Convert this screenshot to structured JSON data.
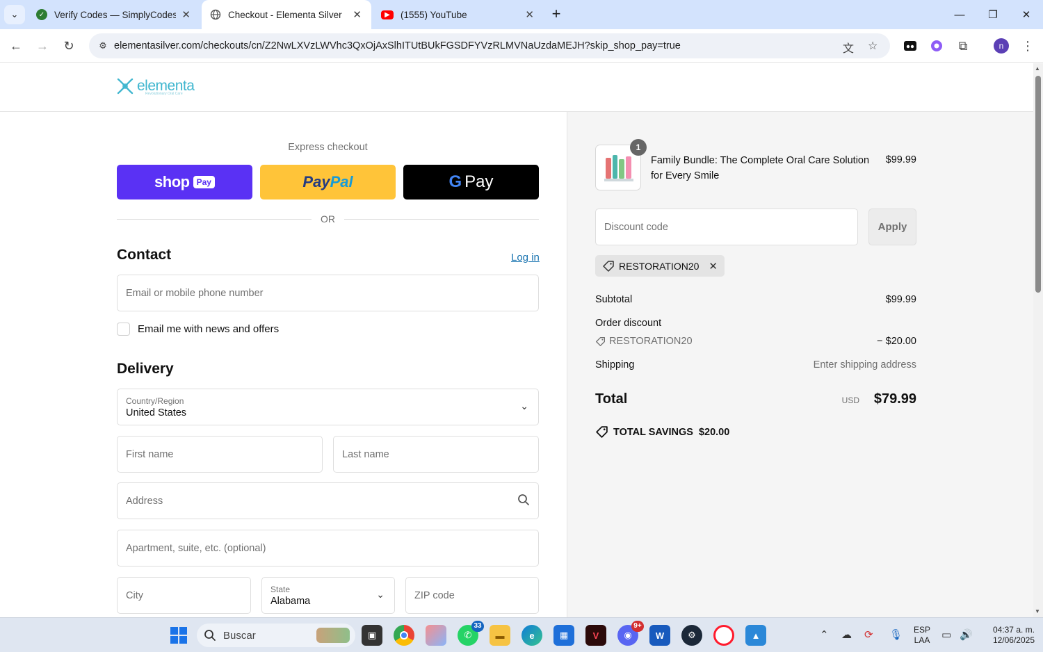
{
  "browser": {
    "tabs": [
      {
        "title": "Verify Codes — SimplyCodes",
        "icon": "simplycodes-icon",
        "color": "#2e7d32"
      },
      {
        "title": "Checkout - Elementa Silver",
        "icon": "globe-icon",
        "active": true
      },
      {
        "title": "(1555) YouTube",
        "icon": "youtube-icon",
        "color": "#ff0000"
      }
    ],
    "url": "elementasilver.com/checkouts/cn/Z2NwLXVzLWVhc3QxOjAxSlhITUtBUkFGSDFYVzRLMVNaUzdaMEJH?skip_shop_pay=true",
    "profile_initial": "n"
  },
  "store": {
    "logo_text": "elementa",
    "logo_sub": "Revolutionary Oral Care"
  },
  "express": {
    "label": "Express checkout",
    "shop": "shop",
    "shop_pay": "Pay",
    "paypal_a": "Pay",
    "paypal_b": "Pal",
    "gpay": "Pay",
    "or": "OR"
  },
  "contact": {
    "heading": "Contact",
    "login": "Log in",
    "email_placeholder": "Email or mobile phone number",
    "newsletter": "Email me with news and offers"
  },
  "delivery": {
    "heading": "Delivery",
    "country_label": "Country/Region",
    "country_value": "United States",
    "first_name": "First name",
    "last_name": "Last name",
    "address": "Address",
    "apartment": "Apartment, suite, etc. (optional)",
    "city": "City",
    "state_label": "State",
    "state_value": "Alabama",
    "zip": "ZIP code"
  },
  "summary": {
    "qty": "1",
    "product_name": "Family Bundle: The Complete Oral Care Solution for Every Smile",
    "product_price": "$99.99",
    "discount_placeholder": "Discount code",
    "apply": "Apply",
    "code": "RESTORATION20",
    "subtotal_label": "Subtotal",
    "subtotal": "$99.99",
    "order_discount_label": "Order discount",
    "discount_code": "RESTORATION20",
    "discount_amount": "− $20.00",
    "shipping_label": "Shipping",
    "shipping_value": "Enter shipping address",
    "total_label": "Total",
    "currency": "USD",
    "total": "$79.99",
    "savings_label": "TOTAL SAVINGS",
    "savings_amount": "$20.00"
  },
  "taskbar": {
    "search": "Buscar",
    "whatsapp_badge": "33",
    "discord_badge": "9+",
    "lang1": "ESP",
    "lang2": "LAA",
    "time": "04:37 a. m.",
    "date": "12/06/2025"
  }
}
